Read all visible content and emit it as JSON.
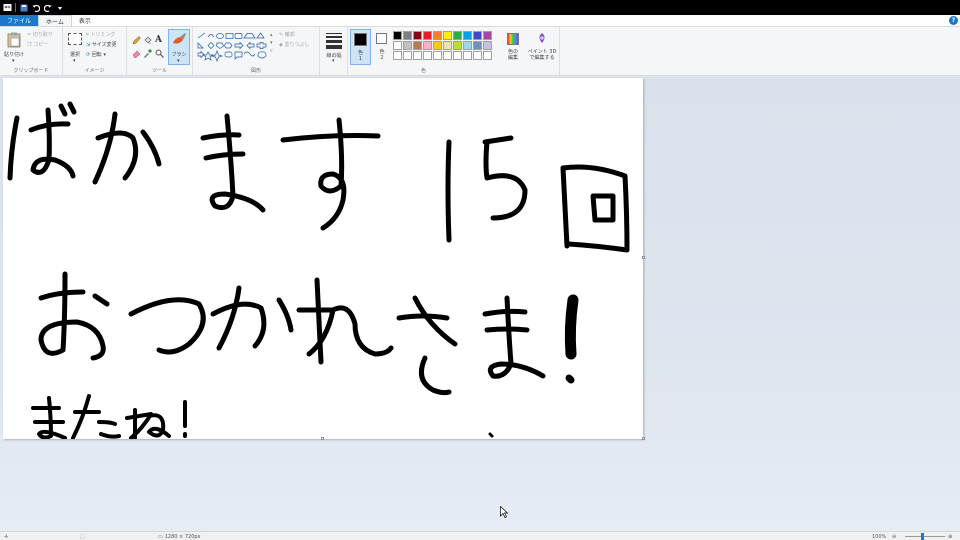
{
  "quick_access": {
    "icons": [
      "paint-app-icon",
      "save-icon",
      "undo-icon",
      "redo-icon",
      "customize-icon"
    ]
  },
  "tabs": {
    "file": "ファイル",
    "home": "ホーム",
    "view": "表示"
  },
  "help_label": "?",
  "ribbon": {
    "clipboard": {
      "label": "クリップボード",
      "paste": "貼り付け",
      "cut": "切り取り",
      "copy": "コピー"
    },
    "image": {
      "label": "イメージ",
      "select": "選択",
      "crop": "トリミング",
      "resize": "サイズ変更",
      "rotate": "回転"
    },
    "tools": {
      "label": "ツール",
      "brush": "ブラシ"
    },
    "shapes": {
      "label": "図形",
      "outline": "輪郭",
      "fill": "塗りつぶし"
    },
    "size": {
      "label": "線の幅"
    },
    "colors": {
      "label": "色",
      "color1": "色\n1",
      "color2": "色\n2",
      "edit_colors": "色の\n編集",
      "paint3d": "ペイント 3D\nで編集する",
      "palette": [
        "#000000",
        "#7f7f7f",
        "#880015",
        "#ed1c24",
        "#ff7f27",
        "#fff200",
        "#22b14c",
        "#00a2e8",
        "#3f48cc",
        "#a349a4",
        "#ffffff",
        "#c3c3c3",
        "#b97a57",
        "#ffaec9",
        "#ffc90e",
        "#efe4b0",
        "#b5e61d",
        "#99d9ea",
        "#7092be",
        "#c8bfe7",
        "#ffffff",
        "#ffffff",
        "#ffffff",
        "#ffffff",
        "#ffffff",
        "#ffffff",
        "#ffffff",
        "#ffffff",
        "#ffffff",
        "#ffffff"
      ]
    }
  },
  "status": {
    "canvas_size": "1280 × 720px",
    "zoom": "100%"
  }
}
